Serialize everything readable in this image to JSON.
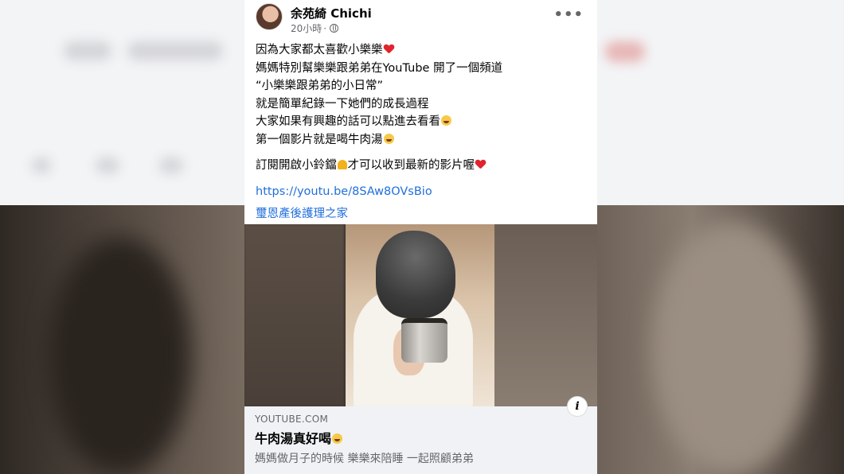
{
  "post": {
    "author": "余苑綺 Chichi",
    "time": "20小時",
    "time_sep": "·",
    "more_label": "•••",
    "lines": [
      "因為大家都太喜歡小樂樂",
      "媽媽特別幫樂樂跟弟弟在YouTube 開了一個頻道",
      "“小樂樂跟弟弟的小日常”",
      "就是簡單紀錄一下她們的成長過程",
      "大家如果有興趣的話可以點進去看看",
      "第一個影片就是喝牛肉湯"
    ],
    "subscribe_a": "訂閱開啟小鈴鐺",
    "subscribe_b": "才可以收到最新的影片喔",
    "link": "https://youtu.be/8SAw8OVsBio",
    "tag": "璽恩產後護理之家",
    "emojis": [
      "red-heart",
      "grinning-face",
      "laughing-face",
      "bell",
      "red-heart"
    ]
  },
  "preview": {
    "domain": "YOUTUBE.COM",
    "title": "牛肉湯真好喝",
    "description": "媽媽做月子的時候 樂樂來陪睡 一起照顧弟弟",
    "info_label": "i"
  },
  "colors": {
    "link": "#216fdb",
    "secondary_text": "#65676b",
    "card_bg": "#ffffff",
    "preview_meta_bg": "#f0f2f5"
  }
}
